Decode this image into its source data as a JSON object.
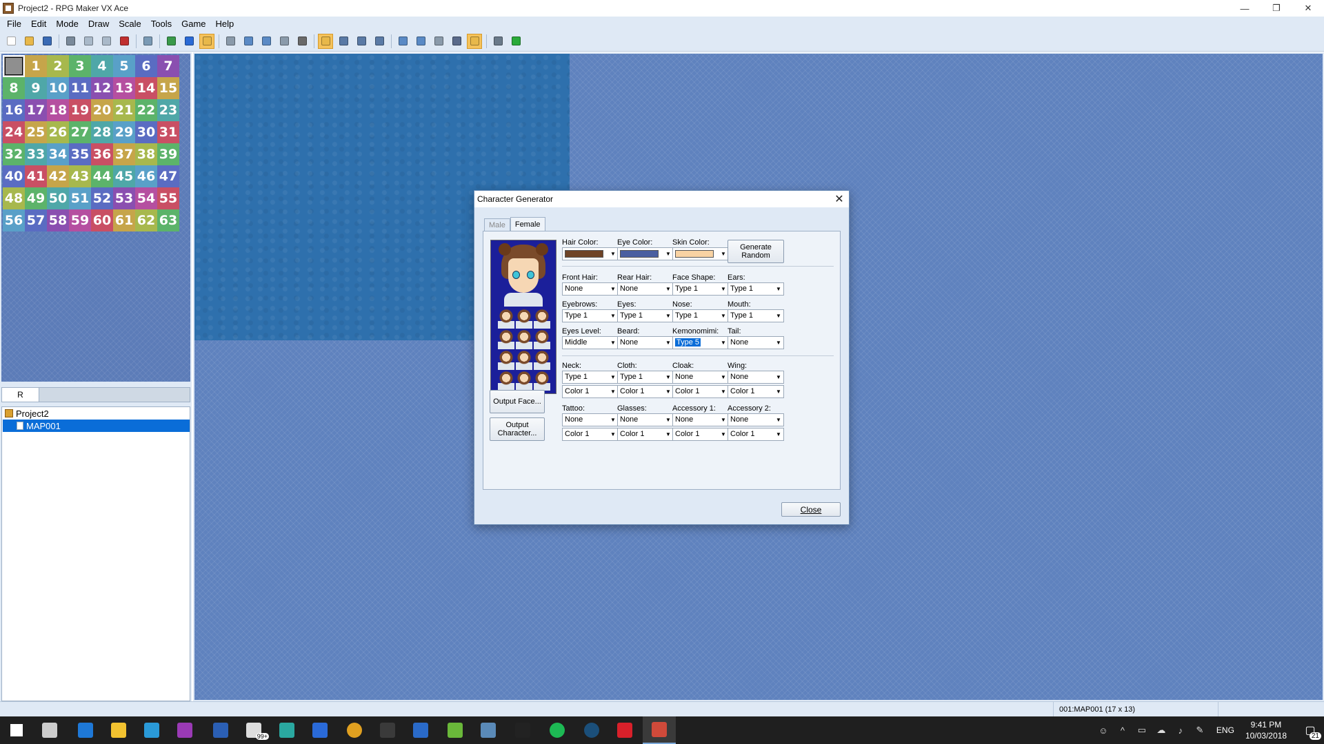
{
  "window": {
    "title": "Project2 - RPG Maker VX Ace",
    "min": "—",
    "restore": "❐",
    "close": "✕"
  },
  "menu": [
    "File",
    "Edit",
    "Mode",
    "Draw",
    "Scale",
    "Tools",
    "Game",
    "Help"
  ],
  "toolbar": {
    "icons": [
      {
        "name": "new-project-icon",
        "color": "#ffffff"
      },
      {
        "name": "open-project-icon",
        "color": "#e8b84a"
      },
      {
        "name": "save-project-icon",
        "color": "#3a6bb5"
      },
      {
        "sep": true
      },
      {
        "name": "cut-icon",
        "color": "#7a8a9a"
      },
      {
        "name": "copy-icon",
        "color": "#a9b9c9"
      },
      {
        "name": "paste-icon",
        "color": "#a9b9c9"
      },
      {
        "name": "delete-icon",
        "color": "#c03030"
      },
      {
        "sep": true
      },
      {
        "name": "undo-icon",
        "color": "#7a9ab5"
      },
      {
        "sep": true
      },
      {
        "name": "map-layer-icon",
        "color": "#3a9a4a"
      },
      {
        "name": "region-layer-icon",
        "color": "#2a6ad5"
      },
      {
        "name": "event-layer-icon",
        "color": "#e8b84a",
        "active": true
      },
      {
        "sep": true
      },
      {
        "name": "pencil-icon",
        "color": "#8a9aaa"
      },
      {
        "name": "rectangle-icon",
        "color": "#5a8ac5"
      },
      {
        "name": "ellipse-icon",
        "color": "#5a8ac5"
      },
      {
        "name": "flood-fill-icon",
        "color": "#8a9aaa"
      },
      {
        "name": "shadow-pen-icon",
        "color": "#6a6a6a"
      },
      {
        "sep": true
      },
      {
        "name": "scale-1-1-icon",
        "color": "#e8b84a",
        "active": true
      },
      {
        "name": "scale-1-2-icon",
        "color": "#5a7aa5"
      },
      {
        "name": "scale-1-4-icon",
        "color": "#5a7aa5"
      },
      {
        "name": "scale-1-8-icon",
        "color": "#5a7aa5"
      },
      {
        "sep": true
      },
      {
        "name": "database-icon",
        "color": "#5a8ac5"
      },
      {
        "name": "resource-manager-icon",
        "color": "#5a8ac5"
      },
      {
        "name": "script-editor-icon",
        "color": "#8a9aaa"
      },
      {
        "name": "sound-test-icon",
        "color": "#5a6a8a"
      },
      {
        "name": "character-generator-icon",
        "color": "#e8b84a",
        "active": true
      },
      {
        "sep": true
      },
      {
        "name": "settings-icon",
        "color": "#6a7a8a"
      },
      {
        "name": "playtest-icon",
        "color": "#2aaa3a"
      }
    ]
  },
  "tiles": {
    "labels": [
      "1",
      "2",
      "3",
      "4",
      "5",
      "6",
      "7",
      "8",
      "9",
      "10",
      "11",
      "12",
      "13",
      "14",
      "15",
      "16",
      "17",
      "18",
      "19",
      "20",
      "21",
      "22",
      "23",
      "24",
      "25",
      "26",
      "27",
      "28",
      "29",
      "30",
      "31",
      "32",
      "33",
      "34",
      "35",
      "36",
      "37",
      "38",
      "39",
      "40",
      "41",
      "42",
      "43",
      "44",
      "45",
      "46",
      "47",
      "48",
      "49",
      "50",
      "51",
      "52",
      "53",
      "54",
      "55",
      "56",
      "57",
      "58",
      "59",
      "60",
      "61",
      "62",
      "63"
    ],
    "colors": [
      "#c94f64",
      "#c6a54a",
      "#a7b84d",
      "#5cb36a",
      "#4fa7a8",
      "#59a0c8",
      "#5a6cc2",
      "#8a4fb0",
      "#b54fa0",
      "#c94f64",
      "#c6a54a",
      "#a7b84d",
      "#5cb36a",
      "#4fa7a8",
      "#59a0c8",
      "#5a6cc2"
    ]
  },
  "layer_tab": "R",
  "tree": {
    "project": "Project2",
    "map": "MAP001"
  },
  "status": {
    "map_info": "001:MAP001 (17 x 13)"
  },
  "dialog": {
    "title": "Character Generator",
    "tabs": [
      "Male",
      "Female"
    ],
    "generate_label": "Generate Random",
    "output_face": "Output Face...",
    "output_character": "Output Character...",
    "close": "Close",
    "colors": {
      "hair": {
        "label": "Hair Color:",
        "swatch": "#6e4326"
      },
      "eye": {
        "label": "Eye Color:",
        "swatch": "#4a5fa0"
      },
      "skin": {
        "label": "Skin Color:",
        "swatch": "#f9d3a3"
      }
    },
    "row1": [
      {
        "label": "Front Hair:",
        "value": "None"
      },
      {
        "label": "Rear Hair:",
        "value": "None"
      },
      {
        "label": "Face Shape:",
        "value": "Type 1"
      },
      {
        "label": "Ears:",
        "value": "Type 1"
      }
    ],
    "row2": [
      {
        "label": "Eyebrows:",
        "value": "Type 1"
      },
      {
        "label": "Eyes:",
        "value": "Type 1"
      },
      {
        "label": "Nose:",
        "value": "Type 1"
      },
      {
        "label": "Mouth:",
        "value": "Type 1"
      }
    ],
    "row3": [
      {
        "label": "Eyes Level:",
        "value": "Middle"
      },
      {
        "label": "Beard:",
        "value": "None"
      },
      {
        "label": "Kemonomimi:",
        "value": "Type 5"
      },
      {
        "label": "Tail:",
        "value": "None"
      }
    ],
    "row4": [
      {
        "label": "Neck:",
        "value": "Type 1",
        "color": "Color 1"
      },
      {
        "label": "Cloth:",
        "value": "Type 1",
        "color": "Color 1"
      },
      {
        "label": "Cloak:",
        "value": "None",
        "color": "Color 1"
      },
      {
        "label": "Wing:",
        "value": "None",
        "color": "Color 1"
      }
    ],
    "row5": [
      {
        "label": "Tattoo:",
        "value": "None",
        "color": "Color 1"
      },
      {
        "label": "Glasses:",
        "value": "None",
        "color": "Color 1"
      },
      {
        "label": "Accessory 1:",
        "value": "None",
        "color": "Color 1"
      },
      {
        "label": "Accessory 2:",
        "value": "None",
        "color": "Color 1"
      }
    ]
  },
  "taskbar": {
    "apps": [
      {
        "name": "start-icon",
        "color": "#ffffff"
      },
      {
        "name": "task-view-icon",
        "color": "#cccccc"
      },
      {
        "name": "edge-icon",
        "color": "#1e78d7"
      },
      {
        "name": "file-explorer-icon",
        "color": "#f2c230"
      },
      {
        "name": "l-app-icon",
        "color": "#2a9ad8"
      },
      {
        "name": "onenote-icon",
        "color": "#9a3ab5"
      },
      {
        "name": "word-icon",
        "color": "#2b5fb4"
      },
      {
        "name": "mail-icon",
        "color": "#dddddd"
      },
      {
        "name": "m-app-icon",
        "color": "#2aa8a0"
      },
      {
        "name": "sourcetree-icon",
        "color": "#2a6ad8"
      },
      {
        "name": "chrome-icon",
        "color": "#e0a020"
      },
      {
        "name": "c-app-icon",
        "color": "#3a3a3a"
      },
      {
        "name": "keepass-icon",
        "color": "#2a6ac8"
      },
      {
        "name": "maps-icon",
        "color": "#6ab83a"
      },
      {
        "name": "steamvr-icon",
        "color": "#5a8ab8"
      },
      {
        "name": "terminal-icon",
        "color": "#222222"
      },
      {
        "name": "spotify-icon",
        "color": "#1db954"
      },
      {
        "name": "steam-icon",
        "color": "#1b4f7a"
      },
      {
        "name": "creative-cloud-icon",
        "color": "#d8202a"
      },
      {
        "name": "rpg-maker-icon",
        "color": "#d04a3a"
      }
    ],
    "mail_badge": "99+",
    "lang": "ENG",
    "time": "9:41 PM",
    "date": "10/03/2018",
    "notif_count": "21"
  }
}
